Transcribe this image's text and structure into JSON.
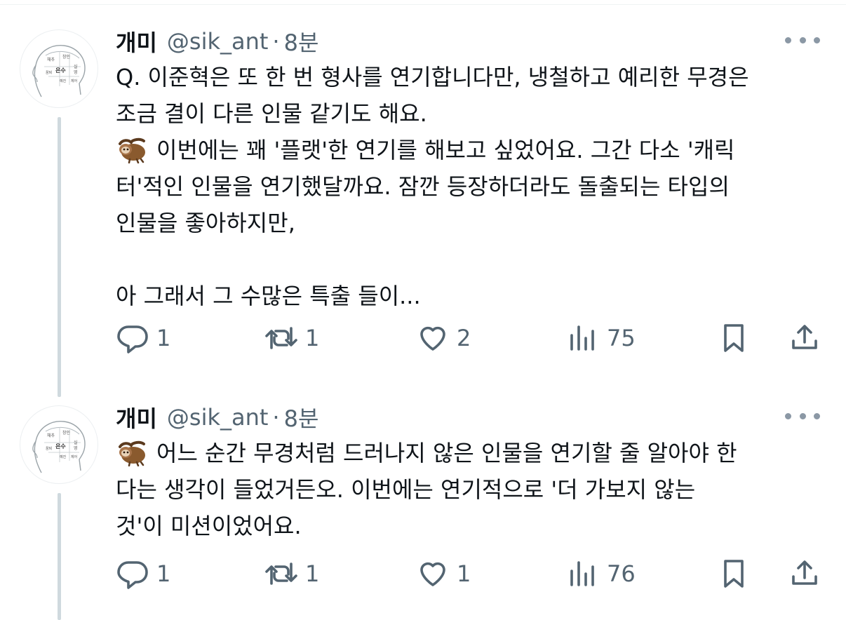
{
  "colors": {
    "text": "#0f1419",
    "secondary": "#536471",
    "thread_line": "#cfd9de",
    "more_dots": "#8b98a5"
  },
  "tweets": [
    {
      "author_name": "개미",
      "handle": "@sik_ant",
      "separator": "·",
      "time": "8분",
      "avatar_lines": [
        "채추",
        "창인",
        "은수",
        "실",
        "영",
        "꿈퇴",
        "예진",
        "체어"
      ],
      "emoji_name": "sloth-emoji",
      "lines": [
        "Q. 이준혁은 또 한 번 형사를 연기합니다만, 냉철하고 예리한 무경은",
        "조금 결이 다른 인물 같기도 해요.",
        "이번에는 꽤 '플랫'한 연기를 해보고 싶었어요. 그간 다소 '캐릭",
        "터'적인 인물을 연기했달까요. 잠깐 등장하더라도 돌출되는 타입의",
        "인물을 좋아하지만,",
        "",
        "아 그래서 그 수많은 특출 들이..."
      ],
      "replies": "1",
      "retweets": "1",
      "likes": "2",
      "views": "75"
    },
    {
      "author_name": "개미",
      "handle": "@sik_ant",
      "separator": "·",
      "time": "8분",
      "avatar_lines": [
        "채추",
        "창인",
        "은수",
        "실",
        "영",
        "꿈퇴",
        "예진",
        "체어"
      ],
      "emoji_name": "sloth-emoji",
      "lines": [
        "어느 순간 무경처럼 드러나지 않은 인물을 연기할 줄 알아야 한",
        "다는 생각이 들었거든오. 이번에는 연기적으로 '더 가보지 않는",
        "것'이 미션이었어요."
      ],
      "replies": "1",
      "retweets": "1",
      "likes": "1",
      "views": "76"
    }
  ]
}
